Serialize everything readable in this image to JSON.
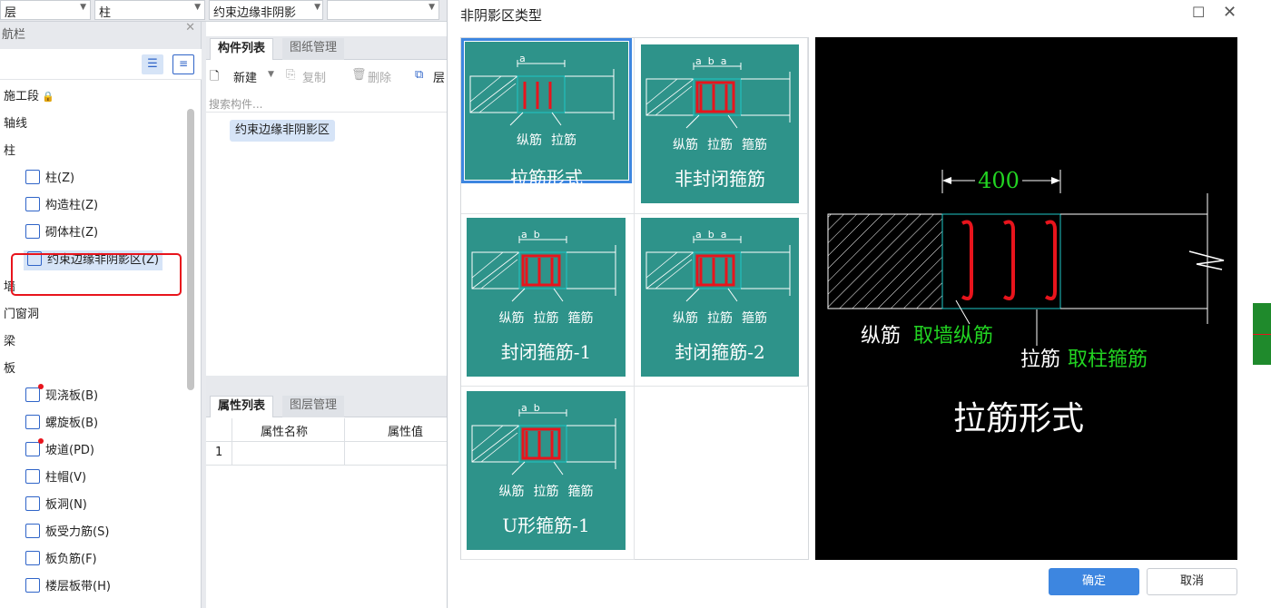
{
  "toolbar": {
    "floor_value": "层",
    "type_value": "柱",
    "component_value": "约束边缘非阴影",
    "empty_value": ""
  },
  "nav": {
    "title": "航栏",
    "tree": [
      {
        "label": "施工段",
        "suffix": "lock-icon"
      },
      {
        "label": "轴线"
      },
      {
        "label": "柱"
      },
      {
        "label": "柱(Z)",
        "icon": "column-icon"
      },
      {
        "label": "构造柱(Z)",
        "icon": "constructional-column-icon"
      },
      {
        "label": "砌体柱(Z)",
        "icon": "masonry-column-icon"
      },
      {
        "label": "约束边缘非阴影区(Z)",
        "icon": "edge-zone-icon",
        "selected": true
      },
      {
        "label": "墙"
      },
      {
        "label": "门窗洞"
      },
      {
        "label": "梁"
      },
      {
        "label": "板"
      },
      {
        "label": "现浇板(B)",
        "icon": "cast-slab-icon"
      },
      {
        "label": "螺旋板(B)",
        "icon": "spiral-slab-icon"
      },
      {
        "label": "坡道(PD)",
        "icon": "ramp-icon"
      },
      {
        "label": "柱帽(V)",
        "icon": "column-cap-icon"
      },
      {
        "label": "板洞(N)",
        "icon": "slab-hole-icon"
      },
      {
        "label": "板受力筋(S)",
        "icon": "slab-rebar-icon"
      },
      {
        "label": "板负筋(F)",
        "icon": "negative-rebar-icon"
      },
      {
        "label": "楼层板带(H)",
        "icon": "slab-strip-icon"
      }
    ]
  },
  "component_panel": {
    "tab_active": "构件列表",
    "tab_inactive": "图纸管理",
    "new_label": "新建",
    "copy_label": "复制",
    "delete_label": "删除",
    "layer_label": "层",
    "search_placeholder": "搜索构件...",
    "item": "约束边缘非阴影区"
  },
  "property_panel": {
    "tab_active": "属性列表",
    "tab_inactive": "图层管理",
    "col_name": "属性名称",
    "col_value": "属性值",
    "row1": "1"
  },
  "dialog": {
    "title": "非阴影区类型",
    "thumbs": [
      {
        "caption": "拉筋形式",
        "labels": [
          "纵筋",
          "拉筋"
        ],
        "dim": "a"
      },
      {
        "caption": "非封闭箍筋",
        "labels": [
          "纵筋",
          "拉筋",
          "箍筋"
        ],
        "dim": "a  b  a"
      },
      {
        "caption": "封闭箍筋-1",
        "labels": [
          "纵筋",
          "拉筋",
          "箍筋"
        ],
        "dim": "a  b"
      },
      {
        "caption": "封闭箍筋-2",
        "labels": [
          "纵筋",
          "拉筋",
          "箍筋"
        ],
        "dim": "a  b  a"
      },
      {
        "caption": "U形箍筋-1",
        "labels": [
          "纵筋",
          "拉筋",
          "箍筋"
        ],
        "dim": "a  b"
      }
    ],
    "preview": {
      "dimension": "400",
      "label_long": "纵筋",
      "label_long_note": "取墙纵筋",
      "label_tie": "拉筋",
      "label_tie_note": "取柱箍筋",
      "title": "拉筋形式"
    },
    "ok_label": "确定",
    "cancel_label": "取消"
  },
  "colors": {
    "accent": "#3d86e0",
    "card": "#2e938a",
    "rebar": "#e8141c",
    "dim_green": "#22d422",
    "selection_red": "#e8141c"
  }
}
